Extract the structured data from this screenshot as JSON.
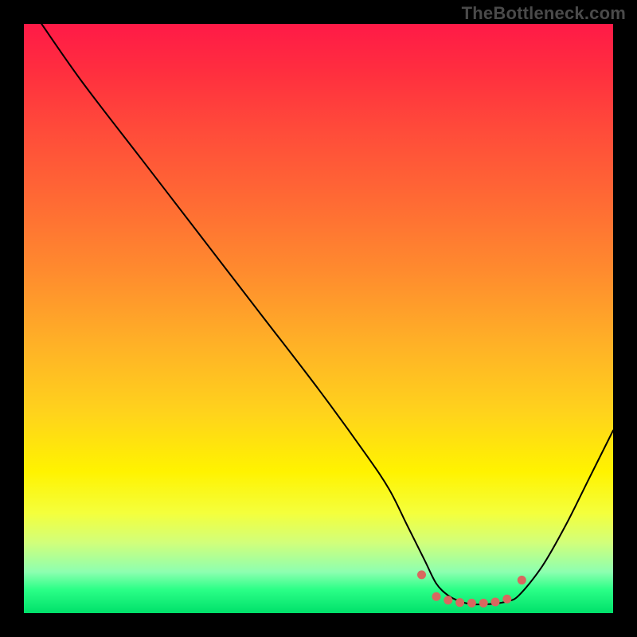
{
  "watermark": "TheBottleneck.com",
  "chart_data": {
    "type": "line",
    "title": "",
    "xlabel": "",
    "ylabel": "",
    "xlim": [
      0,
      100
    ],
    "ylim": [
      0,
      100
    ],
    "grid": false,
    "legend": false,
    "x": [
      3,
      10,
      20,
      30,
      40,
      50,
      58,
      62,
      65,
      68,
      70,
      72,
      74,
      76,
      78,
      80,
      82,
      84,
      88,
      92,
      96,
      100
    ],
    "y": [
      100,
      90,
      77,
      64,
      51,
      38,
      27,
      21,
      15,
      9,
      5,
      3,
      2,
      1.5,
      1.5,
      1.6,
      2,
      3,
      8,
      15,
      23,
      31
    ],
    "dot_series": {
      "x": [
        67.5,
        70,
        72,
        74,
        76,
        78,
        80,
        82,
        84.5
      ],
      "y": [
        6.5,
        2.8,
        2.2,
        1.8,
        1.7,
        1.7,
        1.9,
        2.4,
        5.6
      ]
    },
    "background_gradient": {
      "top_color": "#ff1a47",
      "bottom_color": "#00e06a"
    },
    "curve_color": "#000000",
    "dot_color": "#d9675f"
  }
}
